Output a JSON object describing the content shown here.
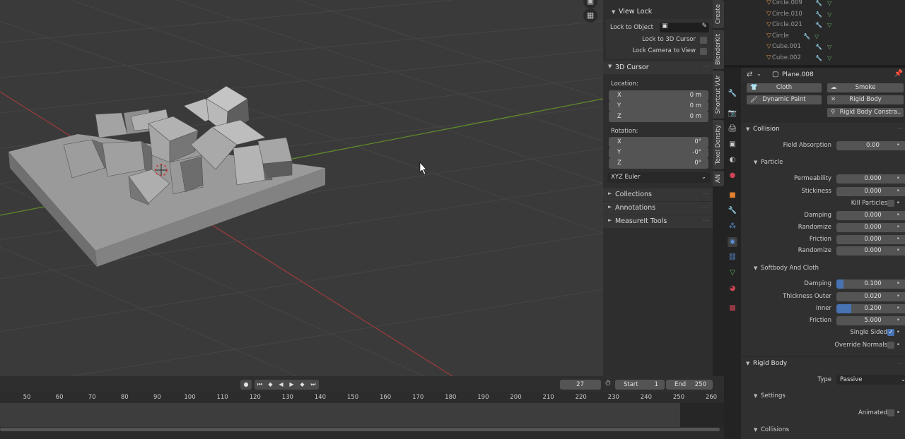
{
  "viewport": {
    "nav_icons": [
      "camera-icon",
      "grid-view-icon"
    ]
  },
  "npanel": {
    "view_lock": {
      "title": "View Lock",
      "lock_to_object_label": "Lock to Object",
      "lock_to_3d_cursor_label": "Lock to 3D Cursor",
      "lock_camera_to_view_label": "Lock Camera to View"
    },
    "cursor": {
      "title": "3D Cursor",
      "location_label": "Location:",
      "loc_x_label": "X",
      "loc_x": "0 m",
      "loc_y_label": "Y",
      "loc_y": "0 m",
      "loc_z_label": "Z",
      "loc_z": "0 m",
      "rotation_label": "Rotation:",
      "rot_x_label": "X",
      "rot_x": "0°",
      "rot_y_label": "Y",
      "rot_y": "-0°",
      "rot_z_label": "Z",
      "rot_z": "0°",
      "rotation_mode": "XYZ Euler"
    },
    "collections_title": "Collections",
    "annotations_title": "Annotations",
    "measureit_title": "MeasureIt Tools"
  },
  "vtabs": [
    "Create",
    "BlenderKit",
    "Shortcut VUr",
    "Texel Density",
    "AN"
  ],
  "timeline": {
    "current_frame": "27",
    "start_label": "Start",
    "start_value": "1",
    "end_label": "End",
    "end_value": "250",
    "ticks": [
      "50",
      "60",
      "70",
      "80",
      "90",
      "100",
      "110",
      "120",
      "130",
      "140",
      "150",
      "160",
      "170",
      "180",
      "190",
      "200",
      "210",
      "220",
      "230",
      "240",
      "250",
      "260"
    ]
  },
  "outliner": {
    "items": [
      "Circle.009",
      "Circle.010",
      "Circle.021",
      "Circle",
      "Cube.001",
      "Cube.002"
    ]
  },
  "properties": {
    "object_name": "Plane.008",
    "physics_buttons": {
      "cloth": "Cloth",
      "smoke": "Smoke",
      "dynamic_paint": "Dynamic Paint",
      "rigid_body": "Rigid Body",
      "rigid_body_constraint": "Rigid Body Constra.."
    },
    "collision": {
      "title": "Collision",
      "field_absorption_label": "Field Absorption",
      "field_absorption": "0.00",
      "particle_title": "Particle",
      "permeability_label": "Permeability",
      "permeability": "0.000",
      "stickiness_label": "Stickiness",
      "stickiness": "0.000",
      "kill_particles_label": "Kill Particles",
      "damping_label": "Damping",
      "damping": "0.000",
      "damping_rand_label": "Randomize",
      "damping_rand": "0.000",
      "friction_label": "Friction",
      "friction": "0.000",
      "friction_rand_label": "Randomize",
      "friction_rand": "0.000",
      "softbody_title": "Softbody And Cloth",
      "sb_damping_label": "Damping",
      "sb_damping": "0.100",
      "sb_damping_fill": 0.1,
      "thickness_outer_label": "Thickness Outer",
      "thickness_outer": "0.020",
      "inner_label": "Inner",
      "inner": "0.200",
      "inner_fill": 0.2,
      "sb_friction_label": "Friction",
      "sb_friction": "5.000",
      "single_sided_label": "Single Sided",
      "override_normals_label": "Override Normals"
    },
    "rigid_body": {
      "title": "Rigid Body",
      "type_label": "Type",
      "type_value": "Passive",
      "settings_title": "Settings",
      "animated_label": "Animated",
      "collisions_title": "Collisions"
    }
  }
}
